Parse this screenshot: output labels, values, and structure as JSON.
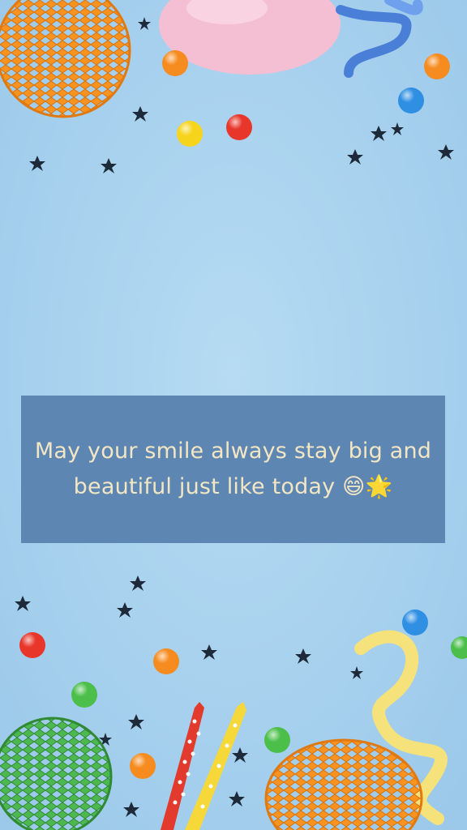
{
  "card": {
    "message": "May your smile always stay big and beautiful just like today 😄🌟"
  },
  "colors": {
    "background": "#a9d2ee",
    "quote_box": "#5d87b2",
    "quote_text": "#f3e6c4",
    "honeycomb_orange": "#f7931e",
    "honeycomb_green": "#48b14a",
    "balloon_pink": "#f4bfd3",
    "ribbon_blue": "#4a7fd8",
    "ribbon_yellow": "#f6e27a",
    "stars": "#1e2a3a"
  },
  "decorations": {
    "candies": [
      "orange",
      "yellow",
      "red",
      "blue",
      "green"
    ],
    "items": [
      "orange-honeycomb-ball",
      "pink-balloon",
      "blue-curly-ribbon",
      "green-honeycomb-ball",
      "red-candle",
      "yellow-candle",
      "yellow-curly-ribbon",
      "confetti-stars"
    ]
  }
}
